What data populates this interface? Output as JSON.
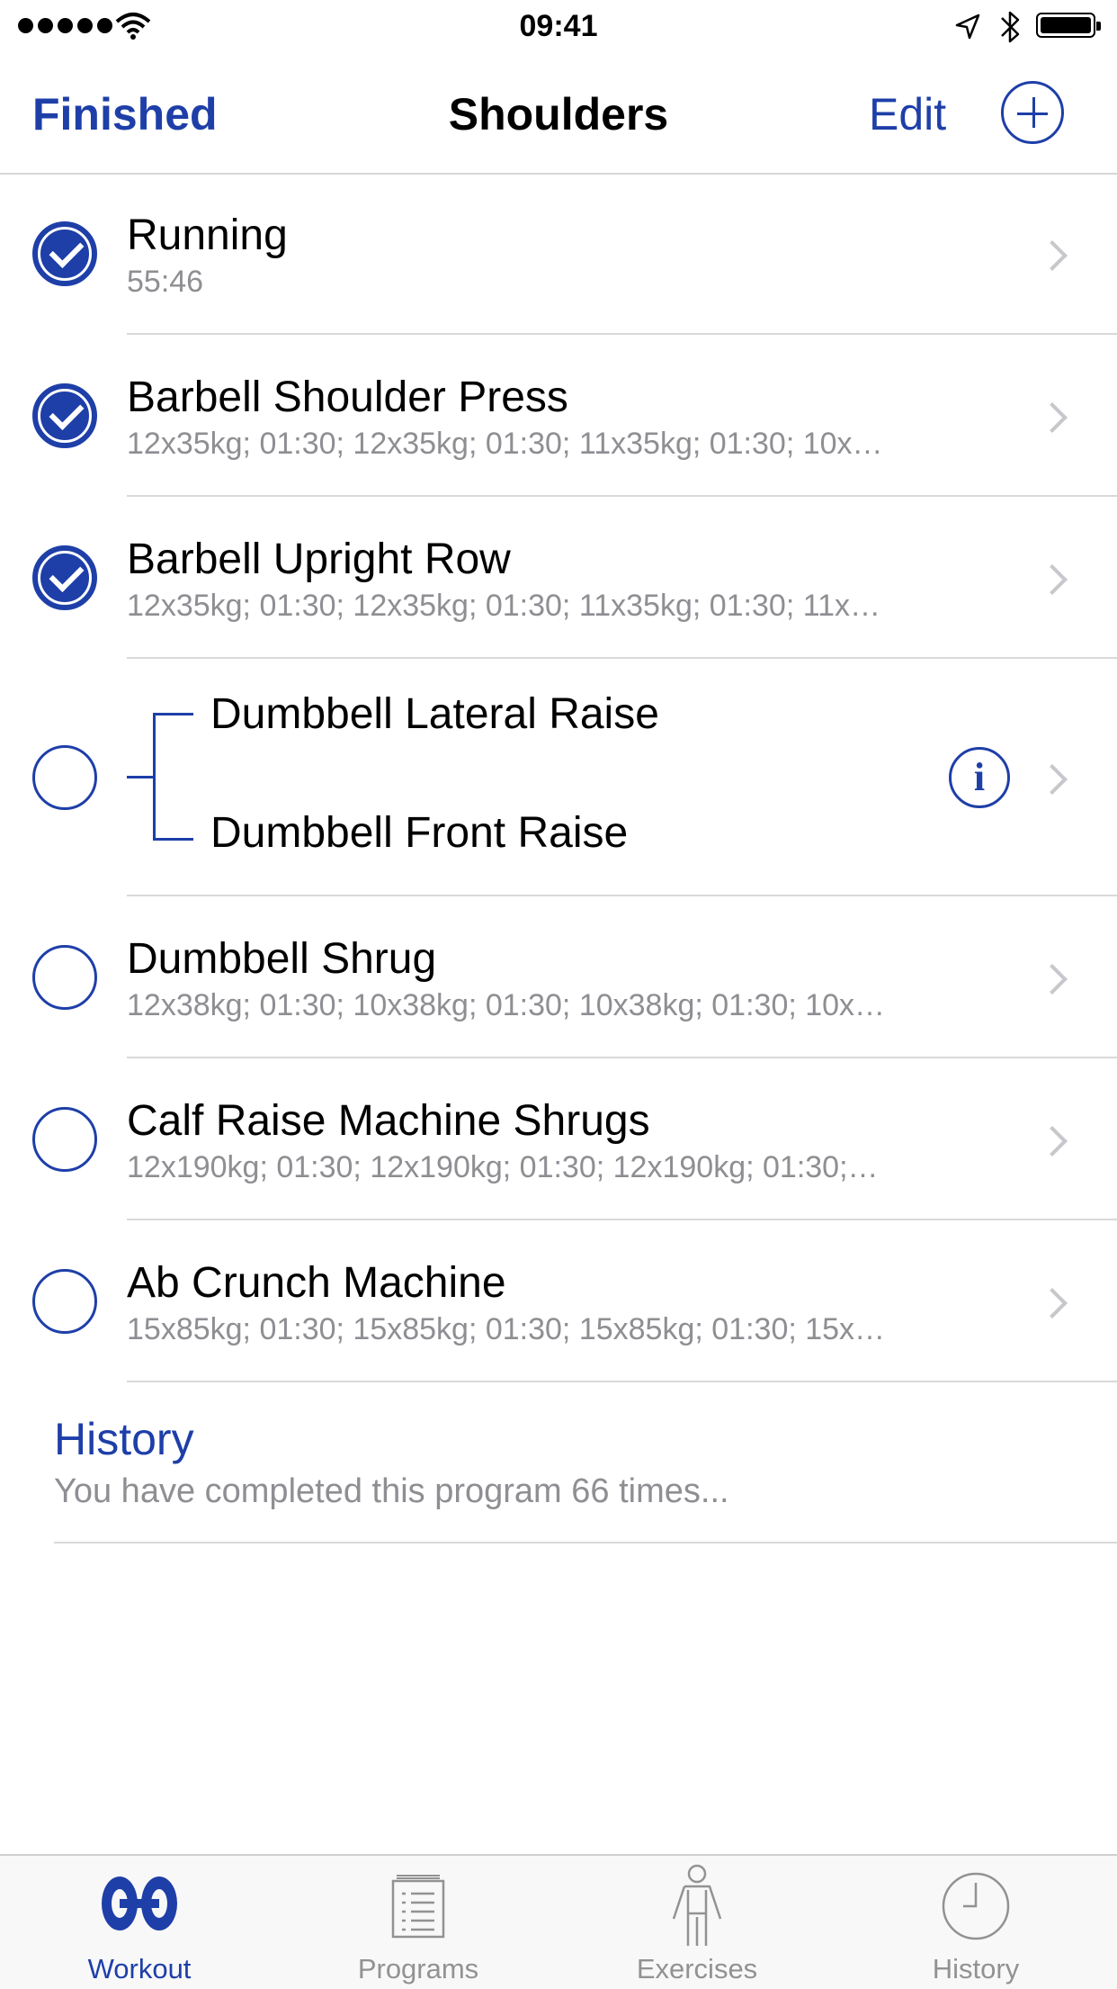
{
  "status_bar": {
    "time": "09:41"
  },
  "nav": {
    "left": "Finished",
    "title": "Shoulders",
    "edit": "Edit"
  },
  "exercises": [
    {
      "title": "Running",
      "subtitle": "55:46",
      "completed": true
    },
    {
      "title": "Barbell Shoulder Press",
      "subtitle": "12x35kg; 01:30; 12x35kg; 01:30; 11x35kg; 01:30; 10x…",
      "completed": true
    },
    {
      "title": "Barbell Upright Row",
      "subtitle": "12x35kg; 01:30; 12x35kg; 01:30; 11x35kg; 01:30; 11x…",
      "completed": true
    },
    {
      "superset": [
        "Dumbbell Lateral Raise",
        "Dumbbell Front Raise"
      ],
      "completed": false
    },
    {
      "title": "Dumbbell Shrug",
      "subtitle": "12x38kg; 01:30; 10x38kg; 01:30; 10x38kg; 01:30; 10x…",
      "completed": false
    },
    {
      "title": "Calf Raise Machine Shrugs",
      "subtitle": "12x190kg; 01:30; 12x190kg; 01:30; 12x190kg; 01:30;…",
      "completed": false
    },
    {
      "title": "Ab Crunch Machine",
      "subtitle": "15x85kg; 01:30; 15x85kg; 01:30; 15x85kg; 01:30; 15x…",
      "completed": false
    }
  ],
  "history": {
    "title": "History",
    "subtitle": "You have completed this program 66 times..."
  },
  "tabs": [
    {
      "label": "Workout",
      "icon": "dumbbell-icon",
      "active": true
    },
    {
      "label": "Programs",
      "icon": "list-icon",
      "active": false
    },
    {
      "label": "Exercises",
      "icon": "person-icon",
      "active": false
    },
    {
      "label": "History",
      "icon": "clock-icon",
      "active": false
    }
  ],
  "colors": {
    "accent": "#1e3fa8",
    "secondary_text": "#8e8e93",
    "separator": "#d9d9d9",
    "chevron": "#c7c7cc"
  }
}
